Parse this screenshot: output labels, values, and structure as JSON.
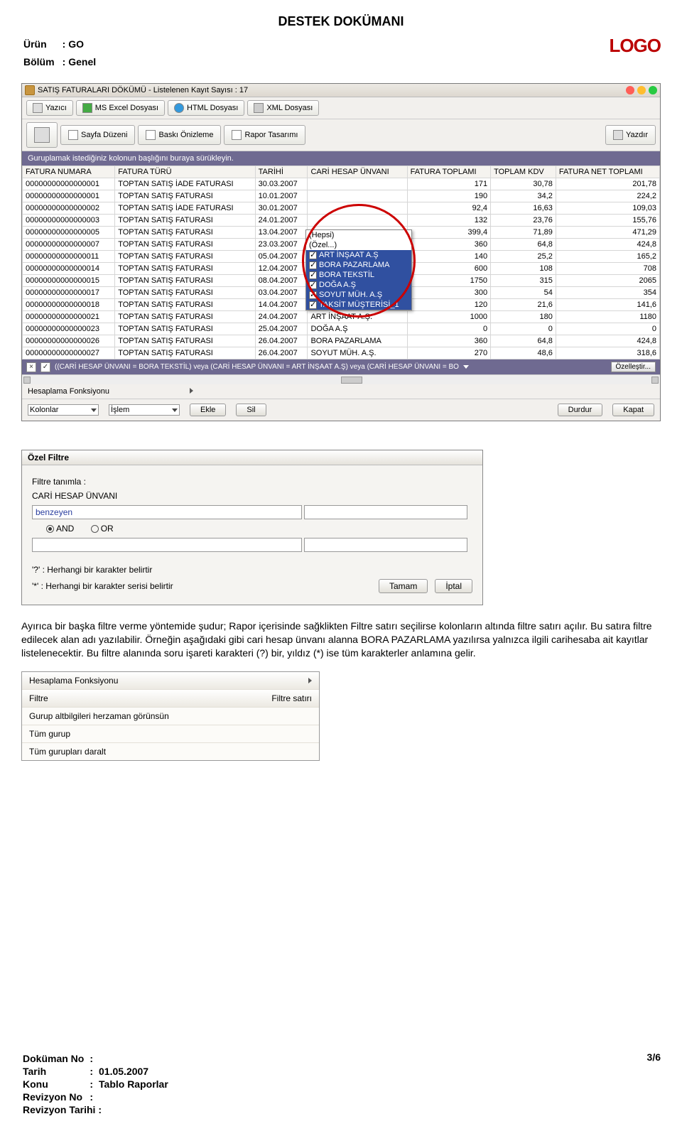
{
  "doc_title": "DESTEK DOKÜMANI",
  "header": {
    "urun_label": "Ürün",
    "urun_value": "GO",
    "bolum_label": "Bölüm",
    "bolum_value": "Genel",
    "colon": ":",
    "logo_text": "LOGO"
  },
  "app": {
    "title": "SATIŞ FATURALARI DÖKÜMÜ  -  Listelenen Kayıt Sayısı : 17",
    "toolbar1": {
      "yazici": "Yazıcı",
      "excel": "MS Excel Dosyası",
      "html": "HTML Dosyası",
      "xml": "XML Dosyası"
    },
    "toolbar2": {
      "sayfa": "Sayfa Düzeni",
      "onizleme": "Baskı Önizleme",
      "tasarim": "Rapor Tasarımı",
      "yazdir": "Yazdır"
    },
    "group_hint": "Guruplamak istediğiniz kolonun başlığını buraya sürükleyin.",
    "columns": [
      "FATURA NUMARA",
      "FATURA TÜRÜ",
      "TARİHİ",
      "CARİ HESAP ÜNVANI",
      "FATURA TOPLAMI",
      "TOPLAM KDV",
      "FATURA NET TOPLAMI"
    ],
    "rows": [
      [
        "00000000000000001",
        "TOPTAN SATIŞ İADE FATURASI",
        "30.03.2007",
        "",
        "171",
        "30,78",
        "201,78"
      ],
      [
        "00000000000000001",
        "TOPTAN SATIŞ FATURASI",
        "10.01.2007",
        "",
        "190",
        "34,2",
        "224,2"
      ],
      [
        "00000000000000002",
        "TOPTAN SATIŞ İADE FATURASI",
        "30.01.2007",
        "",
        "92,4",
        "16,63",
        "109,03"
      ],
      [
        "00000000000000003",
        "TOPTAN SATIŞ FATURASI",
        "24.01.2007",
        "",
        "132",
        "23,76",
        "155,76"
      ],
      [
        "00000000000000005",
        "TOPTAN SATIŞ FATURASI",
        "13.04.2007",
        "",
        "399,4",
        "71,89",
        "471,29"
      ],
      [
        "00000000000000007",
        "TOPTAN SATIŞ FATURASI",
        "23.03.2007",
        "",
        "360",
        "64,8",
        "424,8"
      ],
      [
        "00000000000000011",
        "TOPTAN SATIŞ FATURASI",
        "05.04.2007",
        "",
        "140",
        "25,2",
        "165,2"
      ],
      [
        "00000000000000014",
        "TOPTAN SATIŞ FATURASI",
        "12.04.2007",
        "",
        "600",
        "108",
        "708"
      ],
      [
        "00000000000000015",
        "TOPTAN SATIŞ FATURASI",
        "08.04.2007",
        "BORA TEKSTİL",
        "1750",
        "315",
        "2065"
      ],
      [
        "00000000000000017",
        "TOPTAN SATIŞ FATURASI",
        "03.04.2007",
        "BORA TEKSTİL",
        "300",
        "54",
        "354"
      ],
      [
        "00000000000000018",
        "TOPTAN SATIŞ FATURASI",
        "14.04.2007",
        "TAKSİT MÜŞTERİSİ_1",
        "120",
        "21,6",
        "141,6"
      ],
      [
        "00000000000000021",
        "TOPTAN SATIŞ FATURASI",
        "24.04.2007",
        "ART İNŞAAT A.Ş.",
        "1000",
        "180",
        "1180"
      ],
      [
        "00000000000000023",
        "TOPTAN SATIŞ FATURASI",
        "25.04.2007",
        "DOĞA A.Ş",
        "0",
        "0",
        "0"
      ],
      [
        "00000000000000026",
        "TOPTAN SATIŞ FATURASI",
        "26.04.2007",
        "BORA PAZARLAMA",
        "360",
        "64,8",
        "424,8"
      ],
      [
        "00000000000000027",
        "TOPTAN SATIŞ FATURASI",
        "26.04.2007",
        "SOYUT MÜH. A.Ş.",
        "270",
        "48,6",
        "318,6"
      ]
    ],
    "filter_dd": {
      "hepsi": "(Hepsi)",
      "ozel": "(Özel...)",
      "opts": [
        "ART İNŞAAT A.Ş",
        "BORA PAZARLAMA",
        "BORA TEKSTİL",
        "DOĞA A.Ş",
        "SOYUT MÜH. A.Ş",
        "TAKSİT MÜŞTERİSİ_1"
      ]
    },
    "filter_bar": {
      "x": "×",
      "check": "✓",
      "expr": "((CARİ HESAP ÜNVANI = BORA TEKSTİL) veya (CARİ HESAP ÜNVANI = ART İNŞAAT A.Ş) veya (CARİ HESAP ÜNVANI = BO",
      "custom": "Özelleştir..."
    },
    "calc": {
      "hdr": "Hesaplama Fonksiyonu",
      "kolonlar": "Kolonlar",
      "islem": "İşlem",
      "ekle": "Ekle",
      "sil": "Sil",
      "durdur": "Durdur",
      "kapat": "Kapat"
    }
  },
  "dlg": {
    "title": "Özel Filtre",
    "tanim": "Filtre tanımla :",
    "field": "CARİ HESAP ÜNVANI",
    "op": "benzeyen",
    "and": "AND",
    "or": "OR",
    "note1": "'?' : Herhangi bir karakter belirtir",
    "note2": "'*' : Herhangi bir karakter serisi belirtir",
    "ok": "Tamam",
    "cancel": "İptal"
  },
  "para1": "Ayırıca bir başka filtre verme yöntemide şudur; Rapor içerisinde sağklikten Filtre satırı seçilirse kolonların altında filtre satırı açılır. Bu satıra filtre edilecek alan adı yazılabilir. Örneğin aşağıdaki gibi cari hesap ünvanı alanna BORA PAZARLAMA yazılırsa yalnızca ilgili carihesaba ait kayıtlar listelenecektir. Bu filtre alanında soru işareti karakteri (?) bir, yıldız (*) ise tüm karakterler anlamına gelir.",
  "ctx": {
    "hesap": "Hesaplama Fonksiyonu",
    "filtre": "Filtre",
    "filtre_satiri": "Filtre satırı",
    "alt": "Gurup altbilgileri herzaman görünsün",
    "tum": "Tüm gurup",
    "daralt": "Tüm gurupları daralt"
  },
  "footer": {
    "dokno": "Doküman No",
    "tarih": "Tarih",
    "tarih_v": "01.05.2007",
    "konu": "Konu",
    "konu_v": "Tablo Raporlar",
    "revno": "Revizyon No",
    "revtarih": "Revizyon Tarihi :",
    "colon": ":",
    "page": "3/6"
  }
}
